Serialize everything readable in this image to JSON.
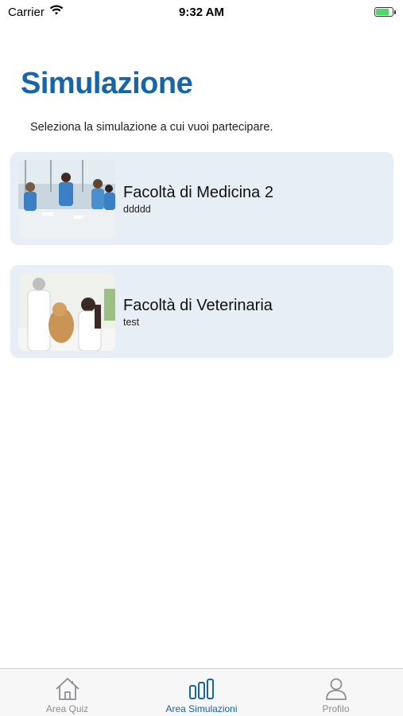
{
  "status_bar": {
    "carrier": "Carrier",
    "time": "9:32 AM",
    "battery_level": 0.8,
    "icons": [
      "wifi-icon",
      "battery-charging-icon"
    ]
  },
  "header": {
    "title": "Simulazione",
    "subtitle": "Seleziona la simulazione a cui vuoi partecipare."
  },
  "simulations": [
    {
      "title": "Facoltà di Medicina 2",
      "subtitle": "ddddd",
      "image": "medical-students-photo"
    },
    {
      "title": "Facoltà di Veterinaria",
      "subtitle": "test",
      "image": "veterinarians-with-dog-photo"
    }
  ],
  "tab_bar": {
    "tabs": [
      {
        "label": "Area Quiz",
        "icon": "home-icon",
        "active": false
      },
      {
        "label": "Area Simulazioni",
        "icon": "bar-chart-icon",
        "active": true
      },
      {
        "label": "Profilo",
        "icon": "person-icon",
        "active": false
      }
    ]
  },
  "colors": {
    "accent": "#1565a8",
    "card_background": "#e7eef6",
    "inactive_tab": "#8e8e93",
    "battery": "#4cd964"
  }
}
